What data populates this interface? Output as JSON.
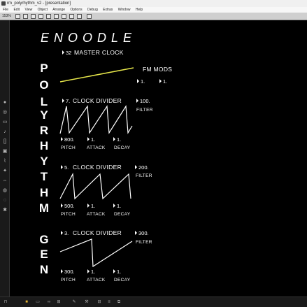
{
  "window": {
    "title": "rm_polyrhythm_v2 - [presentation]"
  },
  "menu": [
    "File",
    "Edit",
    "View",
    "Object",
    "Arrange",
    "Options",
    "Debug",
    "Extras",
    "Window",
    "Help"
  ],
  "toolbar": {
    "zoom": "153%"
  },
  "patch": {
    "logo": "ENOODLE",
    "vertical_word_1": [
      "P",
      "O",
      "L",
      "Y",
      "R",
      "H",
      "Y",
      "T",
      "H",
      "M"
    ],
    "vertical_word_2": [
      "G",
      "E",
      "N"
    ],
    "master": {
      "value": "32",
      "label": "MASTER CLOCK"
    },
    "fm": {
      "label": "FM MODS",
      "value_a": "1.",
      "value_b": "1."
    },
    "dividers": [
      {
        "value": "7.",
        "label": "CLOCK DIVIDER",
        "filter_value": "100.",
        "filter_label": "FILTER",
        "pitch_value": "800.",
        "attack_value": "1.",
        "decay_value": "1.",
        "pitch_label": "PITCH",
        "attack_label": "ATTACK",
        "decay_label": "DECAY"
      },
      {
        "value": "5.",
        "label": "CLOCK DIVIDER",
        "filter_value": "200.",
        "filter_label": "FILTER",
        "pitch_value": "500.",
        "attack_value": "1.",
        "decay_value": "1.",
        "pitch_label": "PITCH",
        "attack_label": "ATTACK",
        "decay_label": "DECAY"
      },
      {
        "value": "3.",
        "label": "CLOCK DIVIDER",
        "filter_value": "300.",
        "filter_label": "FILTER",
        "pitch_value": "300.",
        "attack_value": "1.",
        "decay_value": "1.",
        "pitch_label": "PITCH",
        "attack_label": "ATTACK",
        "decay_label": "DECAY"
      }
    ],
    "colors": {
      "fm_line": "#e6e64a",
      "wave": "#ffffff",
      "background": "#000000"
    }
  }
}
